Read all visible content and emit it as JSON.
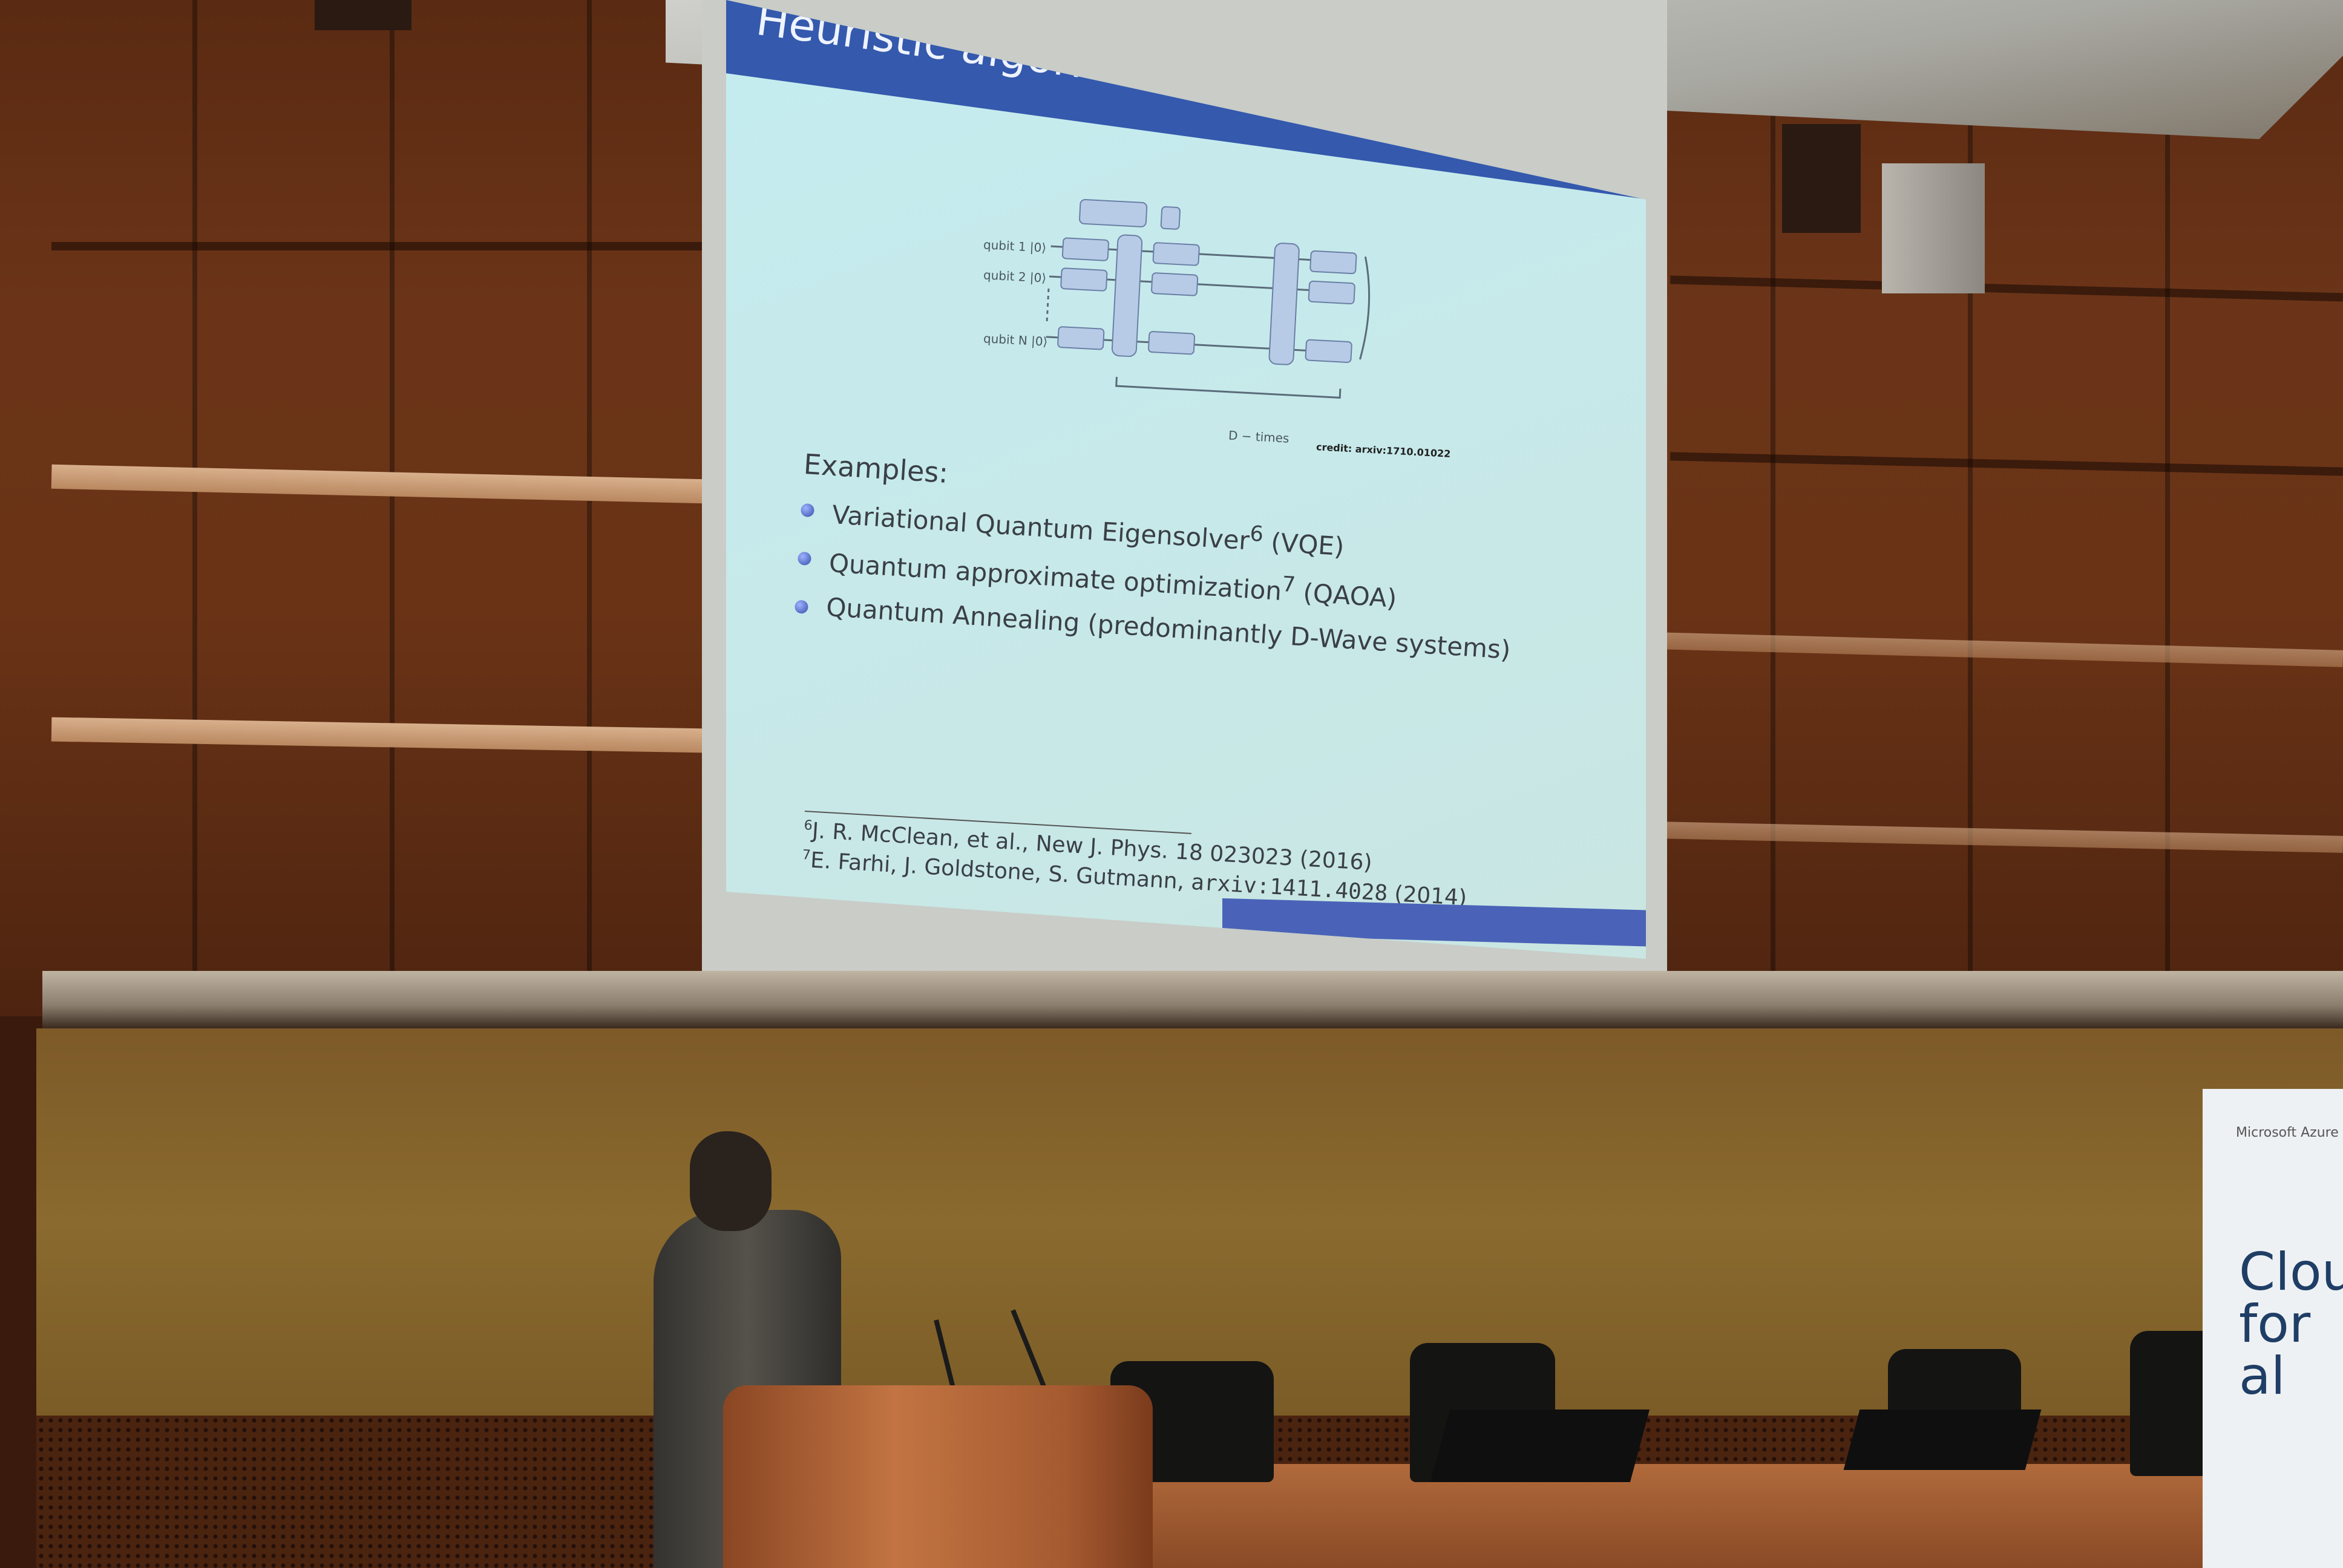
{
  "slide": {
    "title": "Heuristic algorithms tailored to near-term devices",
    "examples_label": "Examples:",
    "bullets": [
      {
        "text": "Variational Quantum Eigensolver",
        "sup": "6",
        "tail": " (VQE)"
      },
      {
        "text": "Quantum approximate optimization",
        "sup": "7",
        "tail": " (QAOA)"
      },
      {
        "text": "Quantum Annealing (predominantly D-Wave systems)",
        "sup": "",
        "tail": ""
      }
    ],
    "references": [
      {
        "num": "6",
        "text": "J. R. McClean, et al., New J. Phys. 18 023023 (2016)"
      },
      {
        "num": "7",
        "text": "E. Farhi, J. Goldstone, S. Gutmann, ",
        "code": "arxiv:1411.4028",
        "tail": " (2014)"
      }
    ],
    "circuit": {
      "qubit_labels": [
        "qubit 1 |0⟩",
        "qubit 2 |0⟩",
        "qubit N |0⟩"
      ],
      "repeat_label": "D − times",
      "credit": "credit: arxiv:1710.01022"
    }
  },
  "banner": {
    "logo": "Microsoft Azure",
    "line1": "Clou",
    "line2": "for al"
  },
  "colors": {
    "slide_bg": "#c6eaea",
    "title_bar": "#3459ad",
    "wood": "#6b3418"
  }
}
